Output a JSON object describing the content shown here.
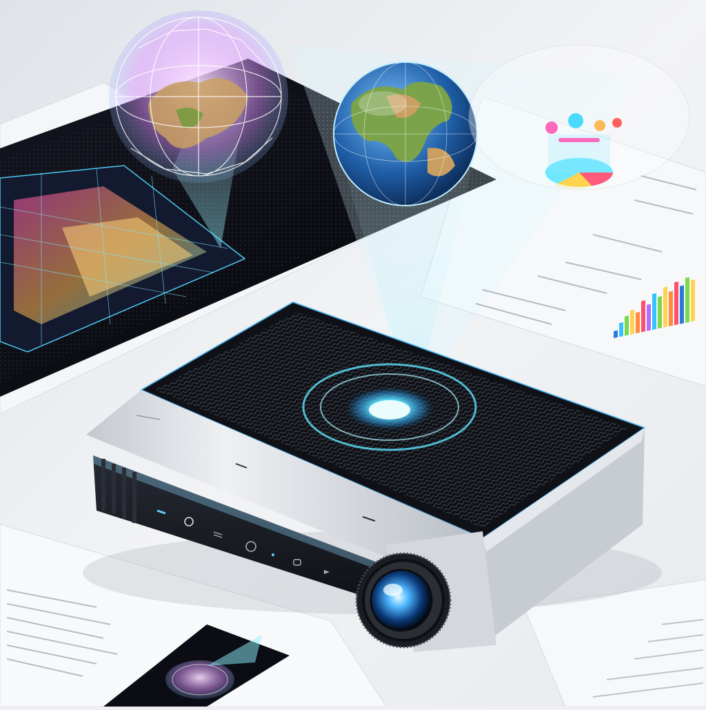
{
  "scene": {
    "subject": "projector-with-holograms",
    "colors": {
      "background": "#eef0f3",
      "hologram_cyan": "#5fe4ff",
      "hologram_magenta": "#e37bff",
      "projector_silver": "#d7dce2",
      "projector_black": "#101217",
      "ocean_blue": "#1f5fa8",
      "land_green": "#7aa34a"
    },
    "icons": [
      "power-icon",
      "menu-icon",
      "settings-icon",
      "wifi-icon",
      "lens-icon",
      "globe-hologram-icon",
      "pie-chart-hologram-icon"
    ]
  }
}
